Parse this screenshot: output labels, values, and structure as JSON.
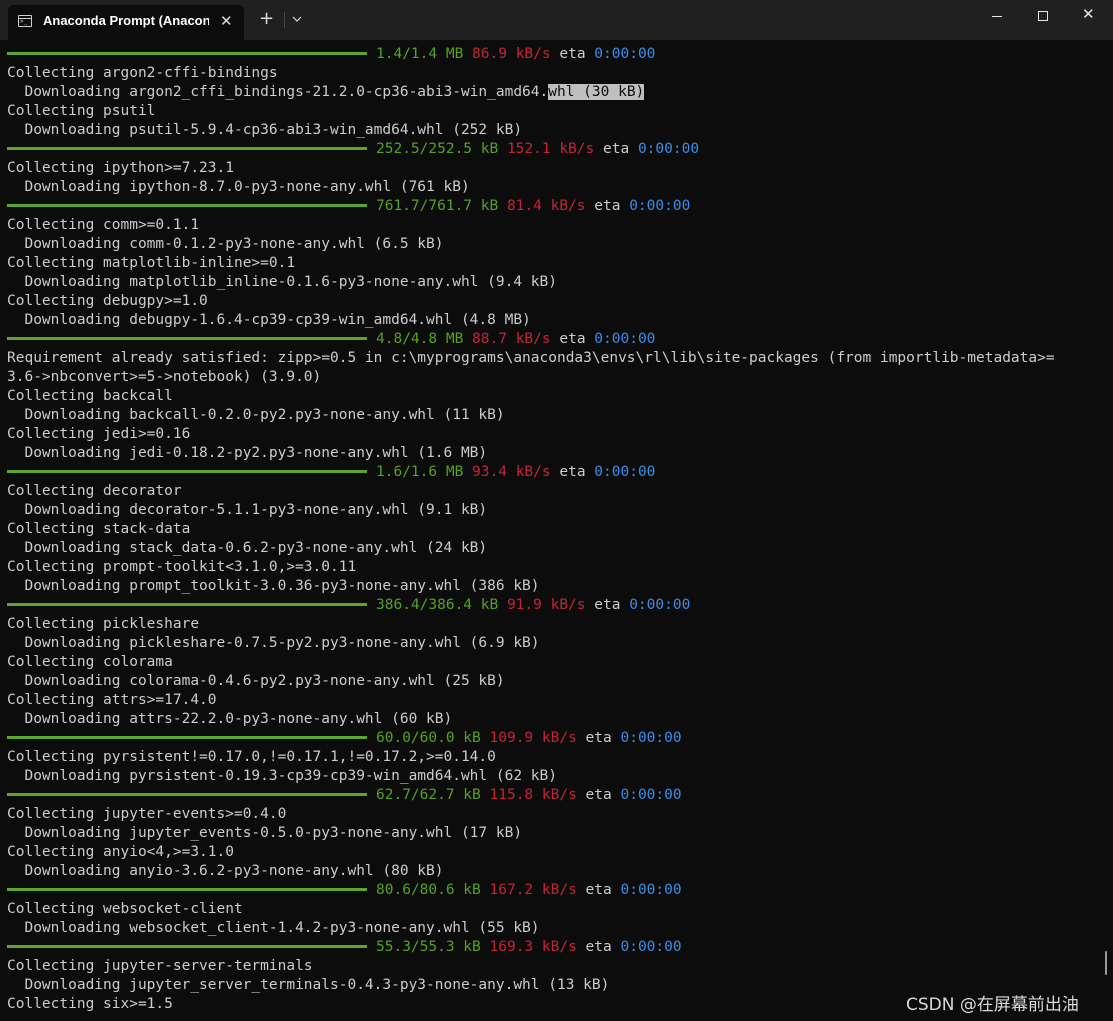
{
  "window": {
    "tab_title": "Anaconda Prompt (Anaconda",
    "icons": {
      "app": "terminal-icon",
      "tab_close": "close-icon",
      "new_tab": "plus-icon",
      "dropdown": "chevron-down-icon",
      "minimize": "minimize-icon",
      "maximize": "maximize-icon",
      "close": "close-icon"
    },
    "glyphs": {
      "tab_close": "✕",
      "new_tab": "+",
      "close": "✕"
    }
  },
  "colors": {
    "background": "#0c0c0c",
    "text": "#cccccc",
    "progress": "#5fa52a",
    "size": "#53a31f",
    "speed": "#c42535",
    "eta": "#3b8ee8"
  },
  "console": [
    {
      "kind": "progress",
      "size": "1.4/1.4 MB",
      "speed": "86.9 kB/s",
      "eta_label": "eta",
      "eta": "0:00:00"
    },
    {
      "kind": "text",
      "text": "Collecting argon2-cffi-bindings"
    },
    {
      "kind": "text",
      "text": "  Downloading argon2_cffi_bindings-21.2.0-cp36-abi3-win_amd64.",
      "selected": "whl (30 kB)"
    },
    {
      "kind": "text",
      "text": "Collecting psutil"
    },
    {
      "kind": "text",
      "text": "  Downloading psutil-5.9.4-cp36-abi3-win_amd64.whl (252 kB)"
    },
    {
      "kind": "progress",
      "size": "252.5/252.5 kB",
      "speed": "152.1 kB/s",
      "eta_label": "eta",
      "eta": "0:00:00"
    },
    {
      "kind": "text",
      "text": "Collecting ipython>=7.23.1"
    },
    {
      "kind": "text",
      "text": "  Downloading ipython-8.7.0-py3-none-any.whl (761 kB)"
    },
    {
      "kind": "progress",
      "size": "761.7/761.7 kB",
      "speed": "81.4 kB/s",
      "eta_label": "eta",
      "eta": "0:00:00"
    },
    {
      "kind": "text",
      "text": "Collecting comm>=0.1.1"
    },
    {
      "kind": "text",
      "text": "  Downloading comm-0.1.2-py3-none-any.whl (6.5 kB)"
    },
    {
      "kind": "text",
      "text": "Collecting matplotlib-inline>=0.1"
    },
    {
      "kind": "text",
      "text": "  Downloading matplotlib_inline-0.1.6-py3-none-any.whl (9.4 kB)"
    },
    {
      "kind": "text",
      "text": "Collecting debugpy>=1.0"
    },
    {
      "kind": "text",
      "text": "  Downloading debugpy-1.6.4-cp39-cp39-win_amd64.whl (4.8 MB)"
    },
    {
      "kind": "progress",
      "size": "4.8/4.8 MB",
      "speed": "88.7 kB/s",
      "eta_label": "eta",
      "eta": "0:00:00"
    },
    {
      "kind": "text",
      "text": "Requirement already satisfied: zipp>=0.5 in c:\\myprograms\\anaconda3\\envs\\rl\\lib\\site-packages (from importlib-metadata>="
    },
    {
      "kind": "text",
      "text": "3.6->nbconvert>=5->notebook) (3.9.0)"
    },
    {
      "kind": "text",
      "text": "Collecting backcall"
    },
    {
      "kind": "text",
      "text": "  Downloading backcall-0.2.0-py2.py3-none-any.whl (11 kB)"
    },
    {
      "kind": "text",
      "text": "Collecting jedi>=0.16"
    },
    {
      "kind": "text",
      "text": "  Downloading jedi-0.18.2-py2.py3-none-any.whl (1.6 MB)"
    },
    {
      "kind": "progress",
      "size": "1.6/1.6 MB",
      "speed": "93.4 kB/s",
      "eta_label": "eta",
      "eta": "0:00:00"
    },
    {
      "kind": "text",
      "text": "Collecting decorator"
    },
    {
      "kind": "text",
      "text": "  Downloading decorator-5.1.1-py3-none-any.whl (9.1 kB)"
    },
    {
      "kind": "text",
      "text": "Collecting stack-data"
    },
    {
      "kind": "text",
      "text": "  Downloading stack_data-0.6.2-py3-none-any.whl (24 kB)"
    },
    {
      "kind": "text",
      "text": "Collecting prompt-toolkit<3.1.0,>=3.0.11"
    },
    {
      "kind": "text",
      "text": "  Downloading prompt_toolkit-3.0.36-py3-none-any.whl (386 kB)"
    },
    {
      "kind": "progress",
      "size": "386.4/386.4 kB",
      "speed": "91.9 kB/s",
      "eta_label": "eta",
      "eta": "0:00:00"
    },
    {
      "kind": "text",
      "text": "Collecting pickleshare"
    },
    {
      "kind": "text",
      "text": "  Downloading pickleshare-0.7.5-py2.py3-none-any.whl (6.9 kB)"
    },
    {
      "kind": "text",
      "text": "Collecting colorama"
    },
    {
      "kind": "text",
      "text": "  Downloading colorama-0.4.6-py2.py3-none-any.whl (25 kB)"
    },
    {
      "kind": "text",
      "text": "Collecting attrs>=17.4.0"
    },
    {
      "kind": "text",
      "text": "  Downloading attrs-22.2.0-py3-none-any.whl (60 kB)"
    },
    {
      "kind": "progress",
      "size": "60.0/60.0 kB",
      "speed": "109.9 kB/s",
      "eta_label": "eta",
      "eta": "0:00:00"
    },
    {
      "kind": "text",
      "text": "Collecting pyrsistent!=0.17.0,!=0.17.1,!=0.17.2,>=0.14.0"
    },
    {
      "kind": "text",
      "text": "  Downloading pyrsistent-0.19.3-cp39-cp39-win_amd64.whl (62 kB)"
    },
    {
      "kind": "progress",
      "size": "62.7/62.7 kB",
      "speed": "115.8 kB/s",
      "eta_label": "eta",
      "eta": "0:00:00"
    },
    {
      "kind": "text",
      "text": "Collecting jupyter-events>=0.4.0"
    },
    {
      "kind": "text",
      "text": "  Downloading jupyter_events-0.5.0-py3-none-any.whl (17 kB)"
    },
    {
      "kind": "text",
      "text": "Collecting anyio<4,>=3.1.0"
    },
    {
      "kind": "text",
      "text": "  Downloading anyio-3.6.2-py3-none-any.whl (80 kB)"
    },
    {
      "kind": "progress",
      "size": "80.6/80.6 kB",
      "speed": "167.2 kB/s",
      "eta_label": "eta",
      "eta": "0:00:00"
    },
    {
      "kind": "text",
      "text": "Collecting websocket-client"
    },
    {
      "kind": "text",
      "text": "  Downloading websocket_client-1.4.2-py3-none-any.whl (55 kB)"
    },
    {
      "kind": "progress",
      "size": "55.3/55.3 kB",
      "speed": "169.3 kB/s",
      "eta_label": "eta",
      "eta": "0:00:00"
    },
    {
      "kind": "text",
      "text": "Collecting jupyter-server-terminals"
    },
    {
      "kind": "text",
      "text": "  Downloading jupyter_server_terminals-0.4.3-py3-none-any.whl (13 kB)"
    },
    {
      "kind": "text",
      "text": "Collecting six>=1.5"
    }
  ],
  "watermark": "CSDN @在屏幕前出油"
}
